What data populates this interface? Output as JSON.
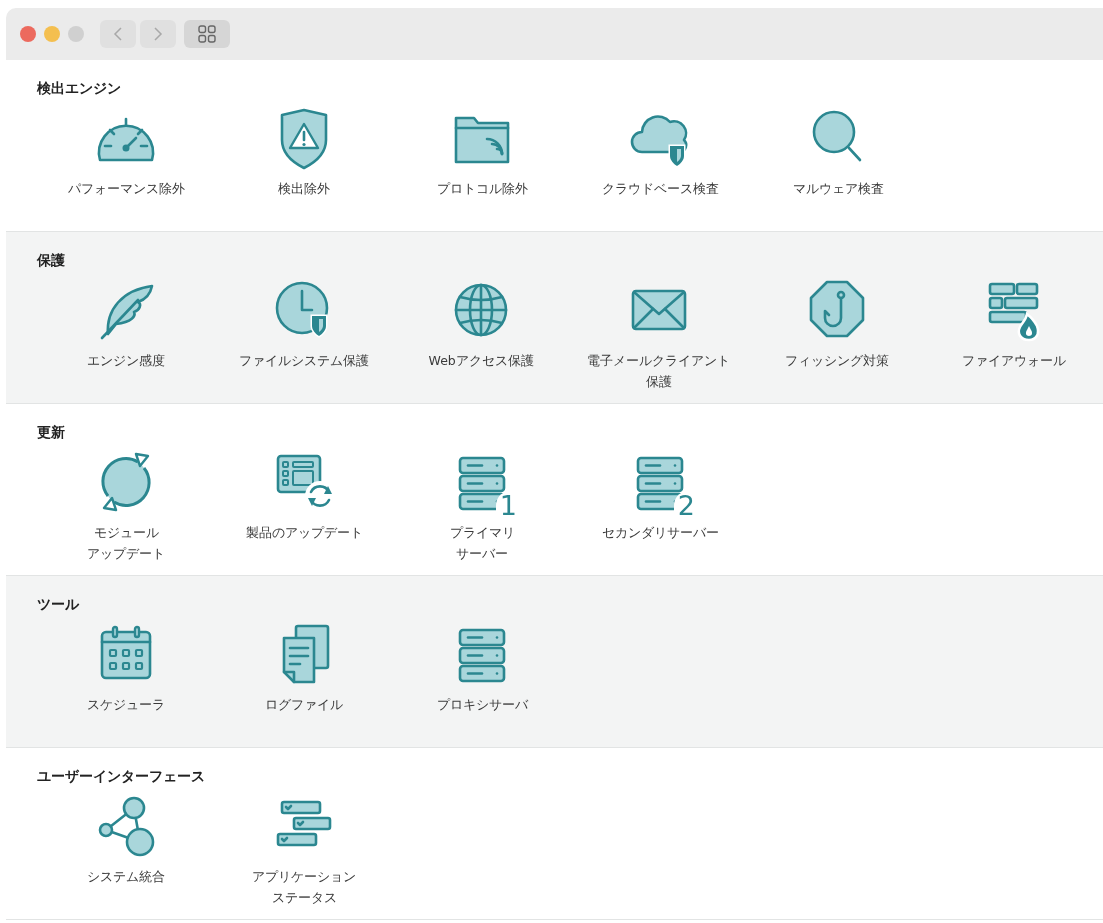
{
  "sections": [
    {
      "title": "検出エンジン",
      "items": [
        {
          "kind": "gauge",
          "label": "パフォーマンス除外"
        },
        {
          "kind": "shield-warning",
          "label": "検出除外"
        },
        {
          "kind": "folder-wave",
          "label": "プロトコル除外"
        },
        {
          "kind": "cloud-shield",
          "label": "クラウドベース検査"
        },
        {
          "kind": "magnifier",
          "label": "マルウェア検査"
        }
      ]
    },
    {
      "title": "保護",
      "items": [
        {
          "kind": "feather",
          "label": "エンジン感度"
        },
        {
          "kind": "clock-shield",
          "label": "ファイルシステム保護"
        },
        {
          "kind": "globe",
          "label": "Webアクセス保護"
        },
        {
          "kind": "envelope",
          "label": "電子メールクライアント保護"
        },
        {
          "kind": "hook",
          "label": "フィッシング対策"
        },
        {
          "kind": "firewall",
          "label": "ファイアウォール"
        }
      ]
    },
    {
      "title": "更新",
      "items": [
        {
          "kind": "sync",
          "label": "モジュールアップデート"
        },
        {
          "kind": "panel-sync",
          "label": "製品のアップデート"
        },
        {
          "kind": "server",
          "badge": "1",
          "label": "プライマリサーバー"
        },
        {
          "kind": "server",
          "badge": "2",
          "label": "セカンダリサーバー"
        }
      ]
    },
    {
      "title": "ツール",
      "items": [
        {
          "kind": "calendar",
          "label": "スケジューラ"
        },
        {
          "kind": "documents",
          "label": "ログファイル"
        },
        {
          "kind": "server",
          "label": "プロキシサーバ"
        }
      ]
    },
    {
      "title": "ユーザーインターフェース",
      "items": [
        {
          "kind": "network",
          "label": "システム統合"
        },
        {
          "kind": "status-bars",
          "label": "アプリケーションステータス"
        }
      ]
    }
  ]
}
